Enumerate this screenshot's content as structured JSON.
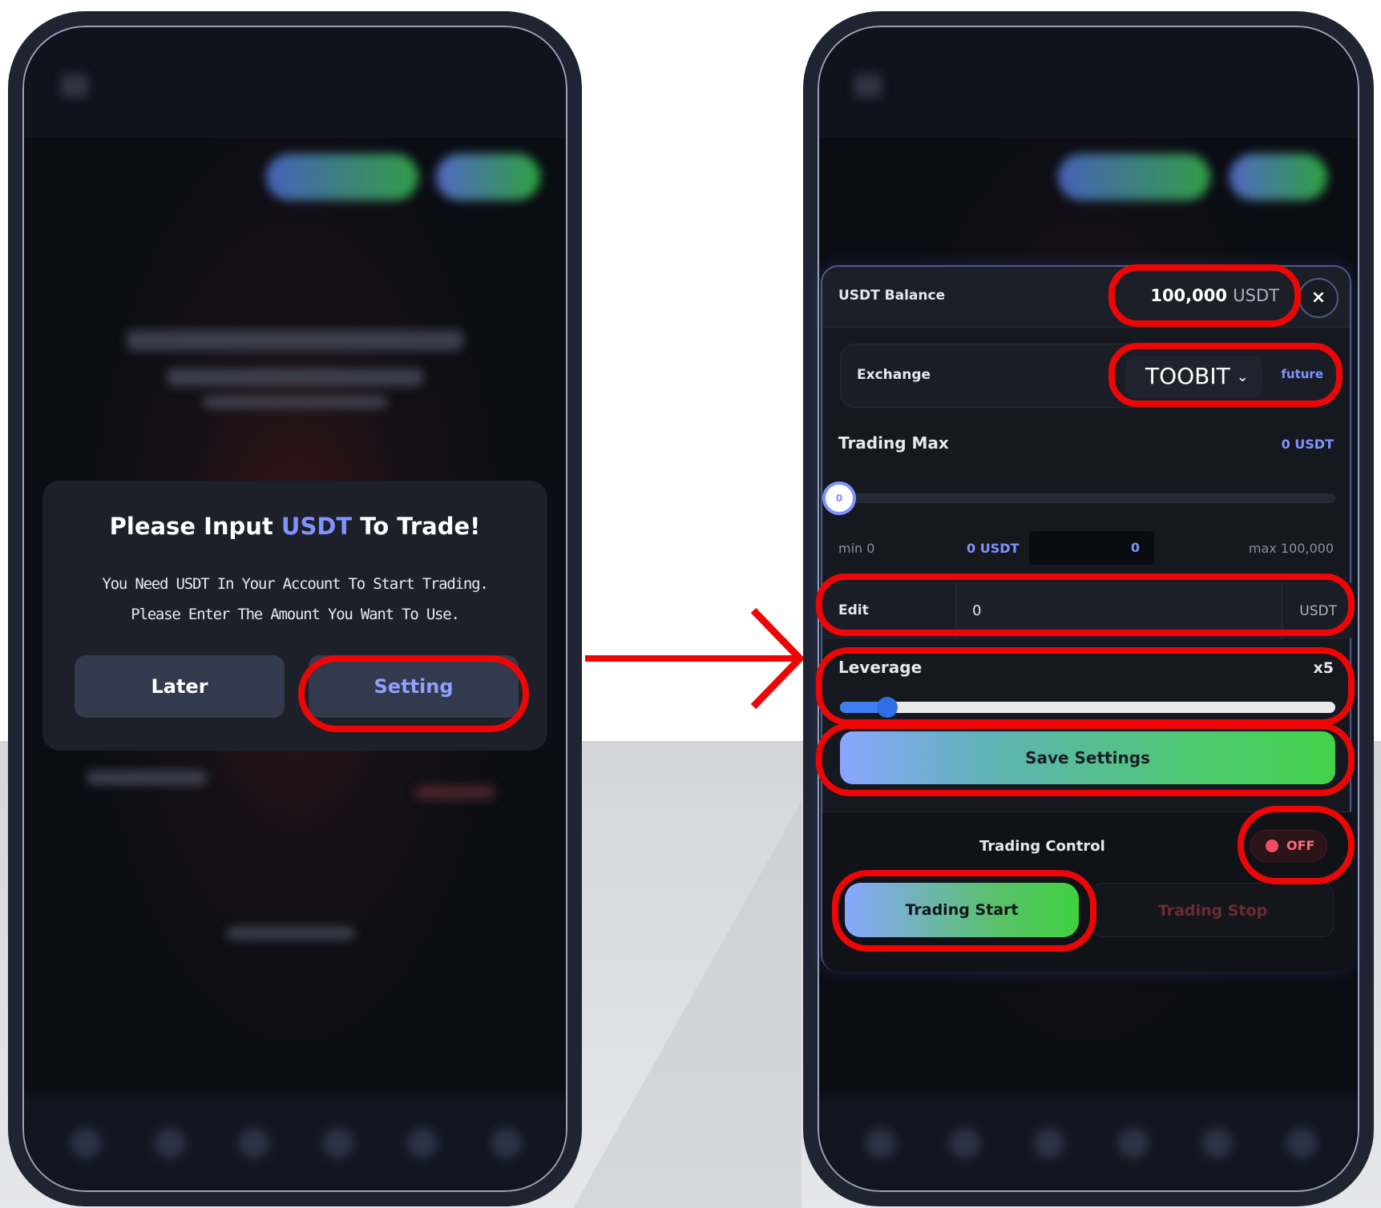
{
  "left_modal": {
    "title_pre": "Please Input ",
    "title_accent": "USDT",
    "title_post": " To Trade!",
    "body_line1": "You Need USDT In Your Account To Start Trading.",
    "body_line2": "Please Enter The Amount You Want To Use.",
    "later_label": "Later",
    "setting_label": "Setting"
  },
  "settings_panel": {
    "balance_label": "USDT Balance",
    "balance_value": "100,000",
    "balance_unit": "USDT",
    "close_icon": "×",
    "exchange_label": "Exchange",
    "exchange_value": "TOOBIT",
    "exchange_type": "future",
    "trading_max_label": "Trading Max",
    "trading_max_value": "0 USDT",
    "slider_knob_value": "0",
    "slider_level": 0,
    "min_label": "min 0",
    "current_value": "0 USDT",
    "amount_input_value": "0",
    "max_label": "max 100,000",
    "edit_label": "Edit",
    "edit_value": "0",
    "edit_unit": "USDT",
    "leverage_label": "Leverage",
    "leverage_value": "x5",
    "leverage_level": 0.06,
    "save_label": "Save Settings",
    "trading_control_label": "Trading Control",
    "toggle_state": "OFF",
    "start_label": "Trading Start",
    "stop_label": "Trading Stop"
  },
  "colors": {
    "accent_blue": "#7f93ff",
    "highlight_red": "#ee0606",
    "save_gradient_start": "#8aa6ff",
    "save_gradient_end": "#42d24a"
  }
}
